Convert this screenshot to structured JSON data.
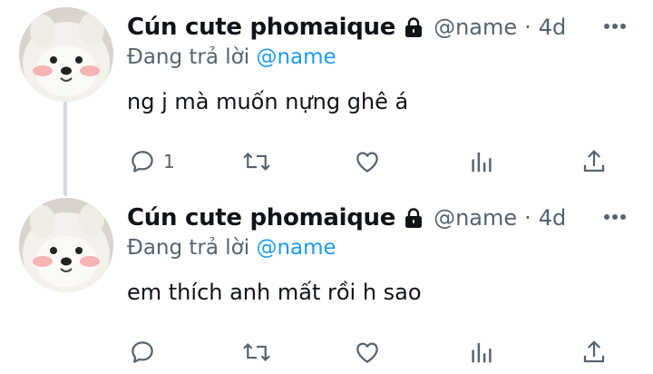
{
  "tweets": [
    {
      "author_name": "Cún cute phomaique",
      "handle": "@name",
      "separator": "·",
      "time": "4d",
      "reply_prefix": "Đang trả lời",
      "reply_to": "@name",
      "text": "ng j mà muốn nựng ghê á",
      "reply_count": "1",
      "protected_icon": "lock-icon"
    },
    {
      "author_name": "Cún cute phomaique",
      "handle": "@name",
      "separator": "·",
      "time": "4d",
      "reply_prefix": "Đang trả lời",
      "reply_to": "@name",
      "text": "em thích anh mất rồi h sao",
      "reply_count": "",
      "protected_icon": "lock-icon"
    }
  ],
  "colors": {
    "text": "#0f1419",
    "secondary": "#536471",
    "link": "#1d9bf0",
    "thread_line": "#cfd9de"
  }
}
